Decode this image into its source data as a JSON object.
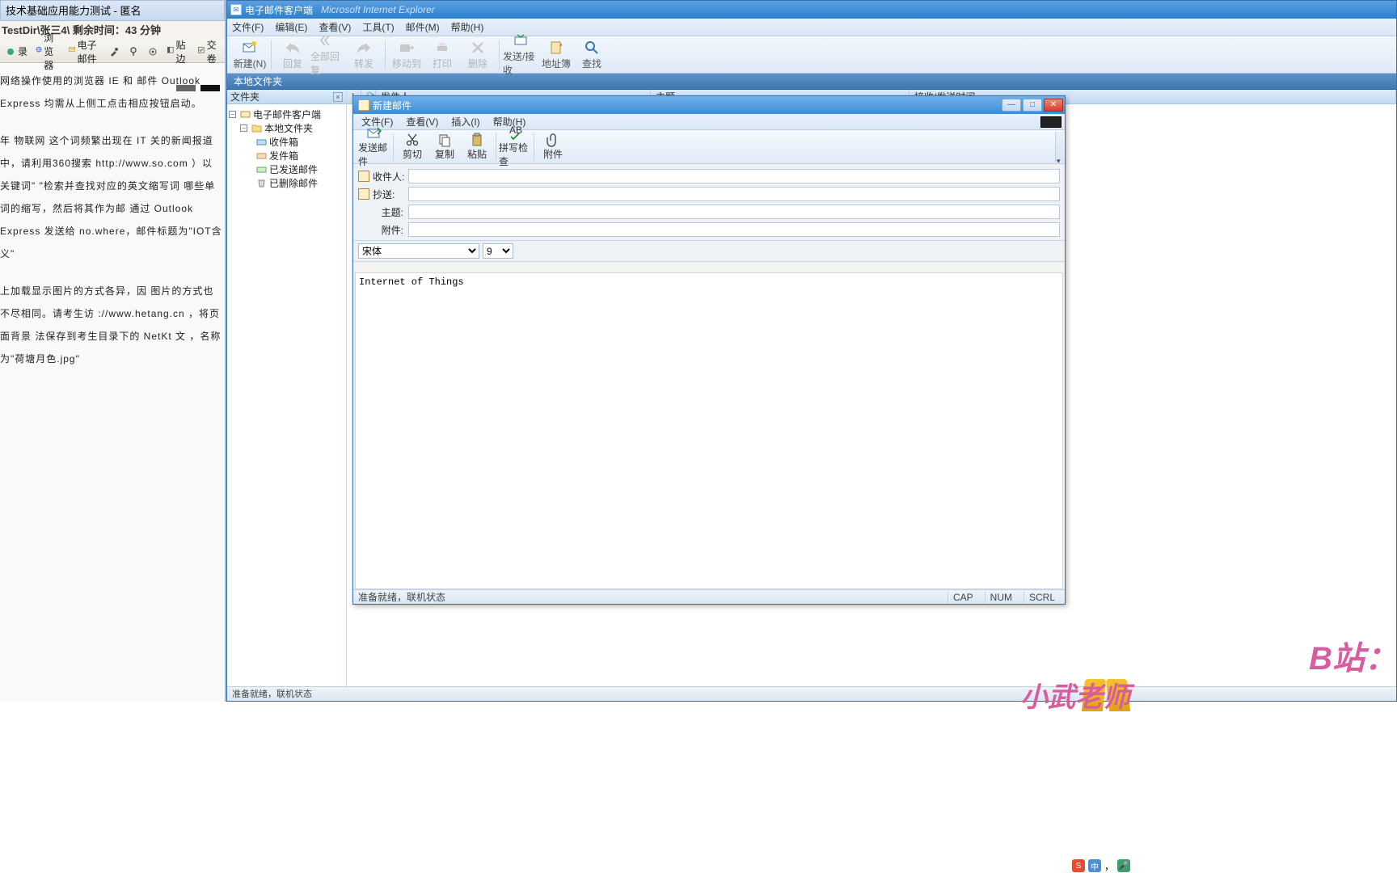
{
  "exam": {
    "title": "技术基础应用能力测试 - 匿名",
    "info": "TestDir\\张三4\\  剩余时间：43 分钟",
    "toolbar": {
      "record": "录",
      "browser": "浏览器",
      "mail": "电子邮件",
      "refresh": "",
      "back": "",
      "fwd": "",
      "paste": "贴边",
      "submit": "交卷"
    },
    "p1": "网络操作使用的浏览器 IE 和 邮件 Outlook Express 均需从上侧工点击相应按钮启动。",
    "p2": "年 物联网 这个词频繁出现在 IT 关的新闻报道中，请利用360搜索 http://www.so.com ）以关键词\" \"检索并查找对应的英文缩写词 哪些单词的缩写，然后将其作为邮 通过 Outlook Express 发送给 no.where，邮件标题为\"IOT含义\"",
    "p3": "上加载显示图片的方式各异，因 图片的方式也不尽相同。请考生访 ://www.hetang.cn ，将页面背景 法保存到考生目录下的 NetKt 文 ，名称为\"荷塘月色.jpg\""
  },
  "mail": {
    "title": "电子邮件客户端",
    "titleFaded": "Microsoft Internet Explorer",
    "menus": {
      "file": "文件(F)",
      "edit": "编辑(E)",
      "view": "查看(V)",
      "tool": "工具(T)",
      "mail": "邮件(M)",
      "help": "帮助(H)"
    },
    "tbtn": {
      "new": "新建(N)",
      "reply": "回复",
      "replyAll": "全部回复",
      "forward": "转发",
      "moveTo": "移动到",
      "print": "打印",
      "delete": "删除",
      "sendRecv": "发送/接收",
      "addrBook": "地址簿",
      "find": "查找"
    },
    "subbar": "本地文件夹",
    "folderHeader": "文件夹",
    "tree": {
      "root": "电子邮件客户端",
      "local": "本地文件夹",
      "inbox": "收件箱",
      "outbox": "发件箱",
      "sent": "已发送邮件",
      "deleted": "已删除邮件"
    },
    "listCols": {
      "flag": "",
      "from": "发件人",
      "subject": "主题",
      "recv": "接收/发送时间"
    },
    "status": "准备就绪，联机状态"
  },
  "compose": {
    "title": "新建邮件",
    "menus": {
      "file": "文件(F)",
      "view": "查看(V)",
      "insert": "插入(I)",
      "help": "帮助(H)"
    },
    "tbtn": {
      "send": "发送邮件",
      "cut": "剪切",
      "copy": "复制",
      "paste": "粘贴",
      "spell": "拼写检查",
      "attach": "附件"
    },
    "labels": {
      "to": "收件人:",
      "cc": "抄送:",
      "subject": "主题:",
      "attach": "附件:"
    },
    "fields": {
      "to": "",
      "cc": "",
      "subject": "",
      "attach": ""
    },
    "font": "宋体",
    "size": "9",
    "body": "Internet of Things",
    "status": "准备就绪，联机状态",
    "ind": {
      "cap": "CAP",
      "num": "NUM",
      "scrl": "SCRL"
    }
  },
  "watermark": {
    "site": "B站：",
    "name": "小武老师"
  },
  "ime": {
    "s": "S",
    "c": "中",
    "dot": "，",
    "m": "🎤"
  }
}
